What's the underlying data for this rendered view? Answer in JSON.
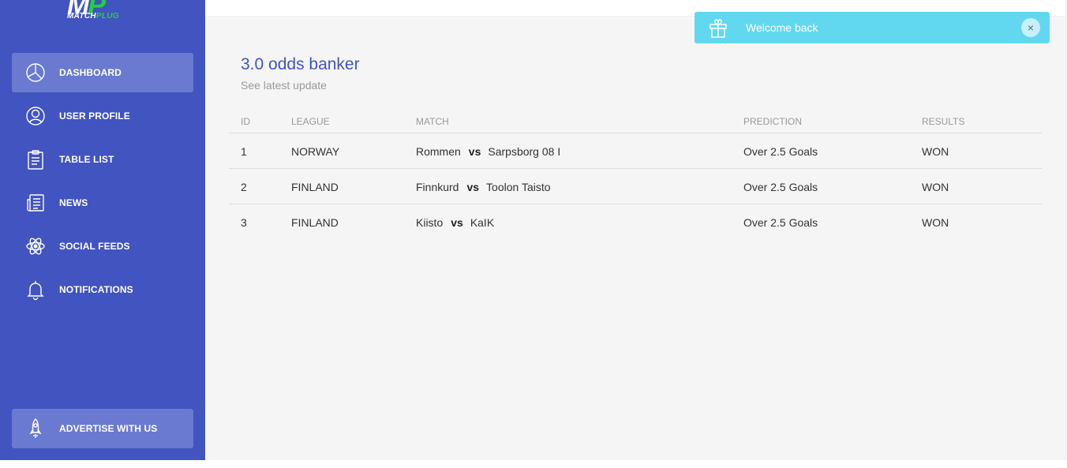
{
  "brand": {
    "logo_mark_main": "M",
    "logo_mark_accent": "P",
    "logo_word_main": "MATCH",
    "logo_word_accent": "PLUG",
    "primary_color": "#4154c0",
    "accent_color": "#22d13a"
  },
  "sidebar": {
    "items": [
      {
        "label": "DASHBOARD",
        "icon": "pie-chart-icon",
        "active": true
      },
      {
        "label": "USER PROFILE",
        "icon": "user-circle-icon",
        "active": false
      },
      {
        "label": "TABLE LIST",
        "icon": "clipboard-list-icon",
        "active": false
      },
      {
        "label": "NEWS",
        "icon": "newspaper-icon",
        "active": false
      },
      {
        "label": "SOCIAL FEEDS",
        "icon": "atom-icon",
        "active": false
      },
      {
        "label": "NOTIFICATIONS",
        "icon": "bell-icon",
        "active": false
      }
    ],
    "advertise": {
      "label": "ADVERTISE WITH US",
      "icon": "rocket-icon"
    }
  },
  "card": {
    "title": "3.0 odds banker",
    "subtitle": "See latest update"
  },
  "table": {
    "headers": {
      "id": "ID",
      "league": "LEAGUE",
      "match": "MATCH",
      "prediction": "PREDICTION",
      "results": "RESULTS"
    },
    "rows": [
      {
        "id": "1",
        "league": "NORWAY",
        "home": "Rommen",
        "vs": "vs",
        "away": "Sarpsborg 08 I",
        "prediction": "Over 2.5 Goals",
        "result": "WON"
      },
      {
        "id": "2",
        "league": "FINLAND",
        "home": "Finnkurd",
        "vs": "vs",
        "away": "Toolon Taisto",
        "prediction": "Over 2.5 Goals",
        "result": "WON"
      },
      {
        "id": "3",
        "league": "FINLAND",
        "home": "Kiisto",
        "vs": "vs",
        "away": "KaIK",
        "prediction": "Over 2.5 Goals",
        "result": "WON"
      }
    ]
  },
  "toast": {
    "message": "Welcome back",
    "icon": "gift-icon",
    "close_icon": "close-icon",
    "close_glyph": "×",
    "color": "#62d8f0"
  }
}
